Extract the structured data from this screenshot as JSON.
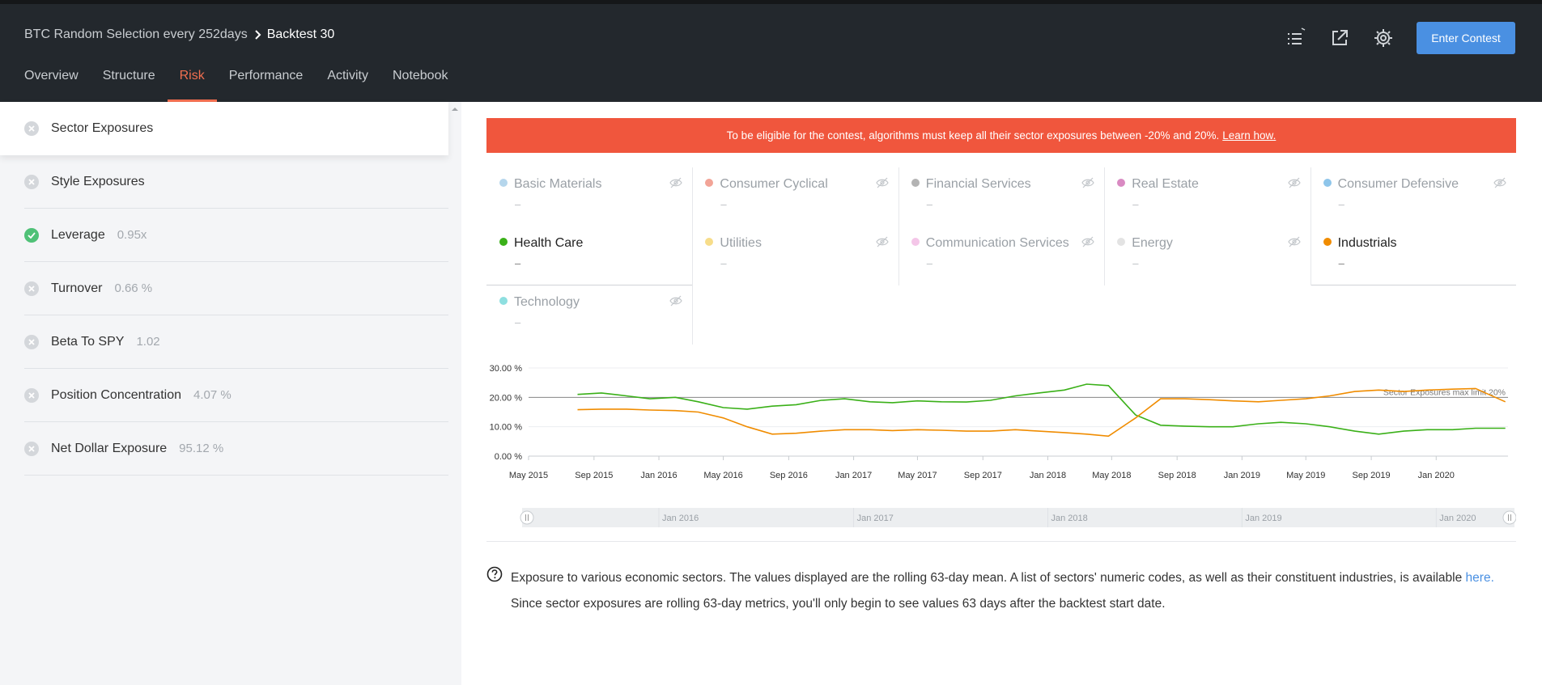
{
  "breadcrumb": {
    "parent": "BTC Random Selection every 252days",
    "current": "Backtest 30"
  },
  "tabs": [
    {
      "label": "Overview",
      "active": false
    },
    {
      "label": "Structure",
      "active": false
    },
    {
      "label": "Risk",
      "active": true
    },
    {
      "label": "Performance",
      "active": false
    },
    {
      "label": "Activity",
      "active": false
    },
    {
      "label": "Notebook",
      "active": false
    }
  ],
  "header_actions": {
    "enter_contest": "Enter Contest",
    "icons": [
      "list-icon",
      "external-link-icon",
      "settings-icon"
    ]
  },
  "sidebar": {
    "items": [
      {
        "label": "Sector Exposures",
        "value": "",
        "status": "fail",
        "active": true
      },
      {
        "label": "Style Exposures",
        "value": "",
        "status": "fail",
        "active": false
      },
      {
        "label": "Leverage",
        "value": "0.95x",
        "status": "pass",
        "active": false
      },
      {
        "label": "Turnover",
        "value": "0.66 %",
        "status": "fail",
        "active": false
      },
      {
        "label": "Beta To SPY",
        "value": "1.02",
        "status": "fail",
        "active": false
      },
      {
        "label": "Position Concentration",
        "value": "4.07 %",
        "status": "fail",
        "active": false
      },
      {
        "label": "Net Dollar Exposure",
        "value": "95.12 %",
        "status": "fail",
        "active": false
      }
    ]
  },
  "alert": {
    "text": "To be eligible for the contest, algorithms must keep all their sector exposures between -20% and 20%.",
    "link": "Learn how."
  },
  "sectors": [
    {
      "name": "Basic Materials",
      "color": "#b5d6ec",
      "value": "–",
      "active": false
    },
    {
      "name": "Consumer Cyclical",
      "color": "#f2a497",
      "value": "–",
      "active": false
    },
    {
      "name": "Financial Services",
      "color": "#b3b3b3",
      "value": "–",
      "active": false
    },
    {
      "name": "Real Estate",
      "color": "#d98ac2",
      "value": "–",
      "active": false
    },
    {
      "name": "Consumer Defensive",
      "color": "#8ec5ea",
      "value": "–",
      "active": false
    },
    {
      "name": "Health Care",
      "color": "#3ab018",
      "value": "–",
      "active": true
    },
    {
      "name": "Utilities",
      "color": "#f7dd8a",
      "value": "–",
      "active": false
    },
    {
      "name": "Communication Services",
      "color": "#f4c6e8",
      "value": "–",
      "active": false
    },
    {
      "name": "Energy",
      "color": "#e3e3e3",
      "value": "–",
      "active": false
    },
    {
      "name": "Industrials",
      "color": "#f08c00",
      "value": "–",
      "active": true
    },
    {
      "name": "Technology",
      "color": "#8edfe0",
      "value": "–",
      "active": false
    }
  ],
  "chart_data": {
    "type": "line",
    "title": "",
    "ylabel": "",
    "xlabel": "",
    "ylim": [
      0,
      30
    ],
    "yticks": [
      "0.00 %",
      "10.00 %",
      "20.00 %",
      "30.00 %"
    ],
    "xticks": [
      "May 2015",
      "Sep 2015",
      "Jan 2016",
      "May 2016",
      "Sep 2016",
      "Jan 2017",
      "May 2017",
      "Sep 2017",
      "Jan 2018",
      "May 2018",
      "Sep 2018",
      "Jan 2019",
      "May 2019",
      "Sep 2019",
      "Jan 2020"
    ],
    "xlim": [
      "2015-05-01",
      "2020-05-15"
    ],
    "grid": true,
    "limit_line": {
      "value": 20,
      "label": "Sector Exposures max limit 20%"
    },
    "x": [
      "2015-08-01",
      "2015-09-15",
      "2015-11-01",
      "2015-12-15",
      "2016-02-01",
      "2016-03-15",
      "2016-05-01",
      "2016-06-15",
      "2016-08-01",
      "2016-09-15",
      "2016-11-01",
      "2016-12-15",
      "2017-02-01",
      "2017-03-15",
      "2017-05-01",
      "2017-06-15",
      "2017-08-01",
      "2017-09-15",
      "2017-11-01",
      "2017-12-15",
      "2018-02-01",
      "2018-03-15",
      "2018-04-25",
      "2018-06-15",
      "2018-08-01",
      "2018-09-15",
      "2018-11-01",
      "2018-12-15",
      "2019-02-01",
      "2019-03-15",
      "2019-05-01",
      "2019-06-15",
      "2019-08-01",
      "2019-09-15",
      "2019-11-01",
      "2019-12-15",
      "2020-02-01",
      "2020-03-15",
      "2020-05-10"
    ],
    "series": [
      {
        "name": "Health Care",
        "color": "#3ab018",
        "values": [
          21.0,
          21.5,
          20.5,
          19.5,
          20.0,
          18.5,
          16.5,
          16.0,
          17.0,
          17.5,
          19.0,
          19.5,
          18.5,
          18.2,
          18.8,
          18.5,
          18.4,
          19.0,
          20.5,
          21.5,
          22.5,
          24.5,
          24.0,
          14.0,
          10.5,
          10.2,
          10.0,
          10.0,
          11.0,
          11.5,
          11.0,
          10.0,
          8.5,
          7.5,
          8.5,
          9.0,
          9.0,
          9.5,
          9.5
        ]
      },
      {
        "name": "Industrials",
        "color": "#f08c00",
        "values": [
          15.8,
          16.0,
          16.0,
          15.7,
          15.5,
          15.0,
          13.0,
          10.0,
          7.5,
          7.8,
          8.5,
          9.0,
          9.0,
          8.7,
          9.0,
          8.8,
          8.5,
          8.5,
          9.0,
          8.5,
          8.0,
          7.5,
          6.8,
          13.0,
          19.5,
          19.5,
          19.2,
          18.8,
          18.5,
          19.0,
          19.5,
          20.5,
          22.0,
          22.5,
          22.0,
          22.5,
          22.8,
          23.0,
          18.5
        ]
      }
    ],
    "navigator_labels": [
      "Jan 2016",
      "Jan 2017",
      "Jan 2018",
      "Jan 2019",
      "Jan 2020"
    ]
  },
  "help": {
    "text1": "Exposure to various economic sectors. The values displayed are the rolling 63-day mean. A list of sectors' numeric codes, as well as their constituent industries, is available",
    "link": "here.",
    "text2": "Since sector exposures are rolling 63-day metrics, you'll only begin to see values 63 days after the backtest start date."
  }
}
